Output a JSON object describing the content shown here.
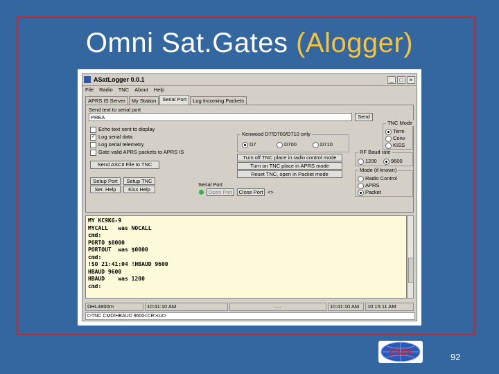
{
  "slide": {
    "title_main": "Omni Sat.Gates",
    "title_accent": "(Alogger)",
    "page_number": "92",
    "logo_text": "UMN",
    "colors": {
      "background": "#3467a0",
      "frame": "#c8262b",
      "accent": "#f6c33a"
    }
  },
  "app": {
    "title": "ASatLogger 0.0.1",
    "window_buttons": [
      "_",
      "□",
      "×"
    ],
    "menu": [
      "File",
      "Radio",
      "TNC",
      "About",
      "Help"
    ],
    "tabs": [
      "APRS IS Server",
      "My Station",
      "Serial Port",
      "Log Incoming Packets"
    ],
    "active_tab": "Serial Port",
    "serial": {
      "send_label": "Send text to serial port",
      "send_value": "PREA",
      "send_button": "Send",
      "checkboxes": [
        {
          "label": "Echo text sent to display",
          "checked": false
        },
        {
          "label": "Log serial data",
          "checked": true
        },
        {
          "label": "Log serial telemetry",
          "checked": false
        },
        {
          "label": "Gate valid APRS packets to APRS IS",
          "checked": false
        }
      ],
      "send_ascii_button": "Send ASCII File to TNC",
      "setup_port_button": "Setup Port",
      "port_help_button": "Ser. Help",
      "setup_tnc_button": "Setup TNC",
      "kiss_help_button": "Kiss Help",
      "serial_port_label": "Serial Port",
      "open_port_button": "Open Port",
      "close_port_button": "Close Port",
      "port_arrows": "<>"
    },
    "tnc_mode": {
      "label": "TNC Mode",
      "options": [
        {
          "label": "Term",
          "selected": true
        },
        {
          "label": "Conv",
          "selected": false
        },
        {
          "label": "KISS",
          "selected": false
        }
      ]
    },
    "kenwood": {
      "label": "Kenwood D7/D700/D710 only",
      "options": [
        {
          "label": "D7",
          "selected": true
        },
        {
          "label": "D700",
          "selected": false
        },
        {
          "label": "D710",
          "selected": false
        }
      ],
      "buttons": [
        "Turn off TNC place in radio control mode",
        "Turn on TNC place in APRS mode",
        "Reset TNC, open in Packet mode"
      ]
    },
    "rf_baud": {
      "label": "RF Baud rate",
      "options": [
        {
          "label": "1200",
          "selected": false
        },
        {
          "label": "9600",
          "selected": true
        }
      ]
    },
    "mode_known": {
      "label": "Mode (if known)",
      "options": [
        {
          "label": "Radio Control",
          "selected": false
        },
        {
          "label": "APRS",
          "selected": false
        },
        {
          "label": "Packet",
          "selected": true
        }
      ]
    },
    "log_lines": [
      "MY KC9KG-9",
      "MYCALL   was NOCALL",
      "cmd:",
      "PORTO $0000",
      "PORTOUT  was $0000",
      "cmd:",
      "!SO 21:41:04 !HBAUD 9600",
      "HBAUD 9600",
      "HBAUD    was 1200",
      "cmd:"
    ],
    "status_bar": [
      "DHL4800m",
      "10:41:10 AM",
      "....",
      "10:41:10 AM",
      "10:15:11 AM"
    ],
    "command_line": "t>TNC CMD!HBAUD 9600<CR>cut>"
  }
}
